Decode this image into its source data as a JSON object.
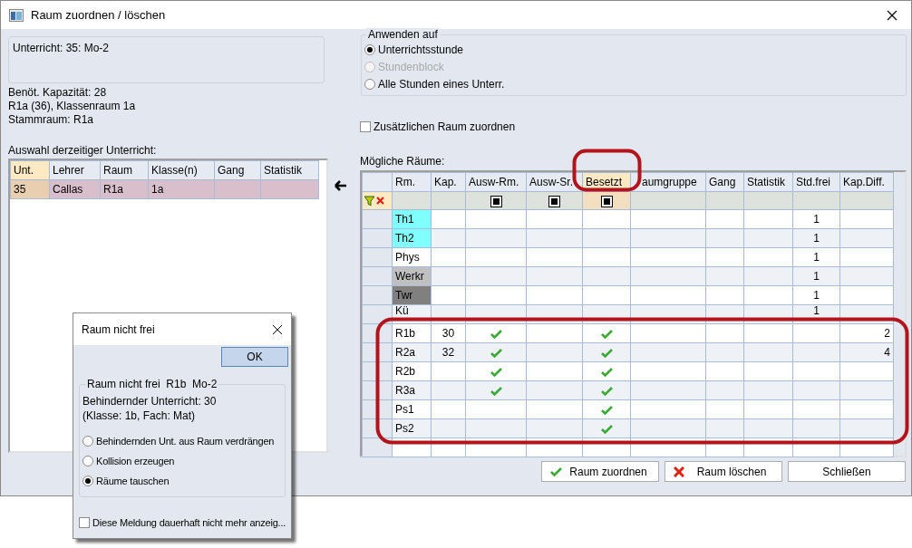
{
  "window": {
    "title": "Raum zuordnen / löschen"
  },
  "lesson_info": "Unterricht: 35: Mo-2",
  "details": [
    "Benöt. Kapazität: 28",
    "R1a (36), Klassenraum 1a",
    "Stammraum: R1a"
  ],
  "current_lessons": {
    "label": "Auswahl derzeitiger Unterricht:",
    "columns": [
      {
        "label": "Unt.",
        "selected": true
      },
      {
        "label": "Lehrer",
        "selected": false
      },
      {
        "label": "Raum",
        "selected": false
      },
      {
        "label": "Klasse(n)",
        "selected": false
      },
      {
        "label": "Gang",
        "selected": false
      },
      {
        "label": "Statistik",
        "selected": false
      }
    ],
    "rows": [
      {
        "selected": true,
        "cells": [
          "35",
          "Callas",
          "R1a",
          "1a"
        ]
      }
    ]
  },
  "apply_to": {
    "legend": "Anwenden auf",
    "options": [
      {
        "label": "Unterrichtsstunde",
        "selected": true,
        "disabled": false
      },
      {
        "label": "Stundenblock",
        "selected": false,
        "disabled": true
      },
      {
        "label": "Alle Stunden eines Unterr.",
        "selected": false,
        "disabled": false
      }
    ]
  },
  "extra_room": {
    "label": "Zusätzlichen Raum zuordnen",
    "checked": false
  },
  "rooms": {
    "label": "Mögliche Räume:",
    "columns": [
      {
        "label": "Rm.",
        "kind": "room",
        "selected": false,
        "filter": false
      },
      {
        "label": "Kap.",
        "kind": "kap",
        "selected": false,
        "filter": false
      },
      {
        "label": "Ausw-Rm.",
        "kind": "ausw_rm",
        "selected": false,
        "filter": true
      },
      {
        "label": "Ausw-Sr.",
        "kind": "ausw_sr",
        "selected": false,
        "filter": true
      },
      {
        "label": "Besetzt",
        "kind": "besetzt",
        "selected": true,
        "filter": true
      },
      {
        "label": "aumgruppe",
        "kind": "raumgruppe",
        "selected": false,
        "filter": false
      },
      {
        "label": "Gang",
        "kind": "gang",
        "selected": false,
        "filter": false
      },
      {
        "label": "Statistik",
        "kind": "statistik",
        "selected": false,
        "filter": false
      },
      {
        "label": "Std.frei",
        "kind": "std_frei",
        "selected": false,
        "filter": false
      },
      {
        "label": "Kap.Diff.",
        "kind": "kap_diff",
        "selected": false,
        "filter": false
      }
    ],
    "rows": [
      {
        "room": "Th1",
        "color": "#80ffff",
        "ausw_rm": false,
        "besetzt": false,
        "std_frei": "1"
      },
      {
        "room": "Th2",
        "color": "#80ffff",
        "ausw_rm": false,
        "besetzt": false,
        "std_frei": "1"
      },
      {
        "room": "Phys",
        "ausw_rm": false,
        "besetzt": false,
        "std_frei": "1"
      },
      {
        "room": "Werkr",
        "color": "#c0c0c0",
        "ausw_rm": false,
        "besetzt": false,
        "std_frei": "1"
      },
      {
        "room": "Twr",
        "color": "#808080",
        "ausw_rm": false,
        "besetzt": false,
        "std_frei": "1"
      },
      {
        "room": "Kü",
        "ausw_rm": false,
        "besetzt": false,
        "std_frei": "1"
      },
      {
        "room": "R1b",
        "kap": "30",
        "ausw_rm": true,
        "besetzt": true,
        "kap_diff": "2"
      },
      {
        "room": "R2a",
        "kap": "32",
        "ausw_rm": true,
        "besetzt": true,
        "kap_diff": "4"
      },
      {
        "room": "R2b",
        "ausw_rm": true,
        "besetzt": true
      },
      {
        "room": "R3a",
        "ausw_rm": true,
        "besetzt": true
      },
      {
        "room": "Ps1",
        "ausw_rm": false,
        "besetzt": true
      },
      {
        "room": "Ps2",
        "ausw_rm": false,
        "besetzt": true
      }
    ]
  },
  "buttons": [
    {
      "label": "Raum zuordnen",
      "kind": "assign"
    },
    {
      "label": "Raum löschen",
      "kind": "delete"
    },
    {
      "label": "Schließen",
      "kind": "plain"
    }
  ],
  "popup": {
    "title": "Raum nicht frei",
    "ok": "OK",
    "legend": "Raum nicht frei  R1b  Mo-2",
    "lines": [
      "Behindernder Unterricht: 30",
      "(Klasse: 1b, Fach: Mat)"
    ],
    "options": [
      {
        "label": "Behindernden Unt. aus Raum verdrängen",
        "selected": false
      },
      {
        "label": "Kollision erzeugen",
        "selected": false
      },
      {
        "label": "Räume tauschen",
        "selected": true
      }
    ],
    "dont_show": {
      "label": "Diese Meldung dauerhaft nicht mehr anzeig...",
      "checked": false
    }
  }
}
